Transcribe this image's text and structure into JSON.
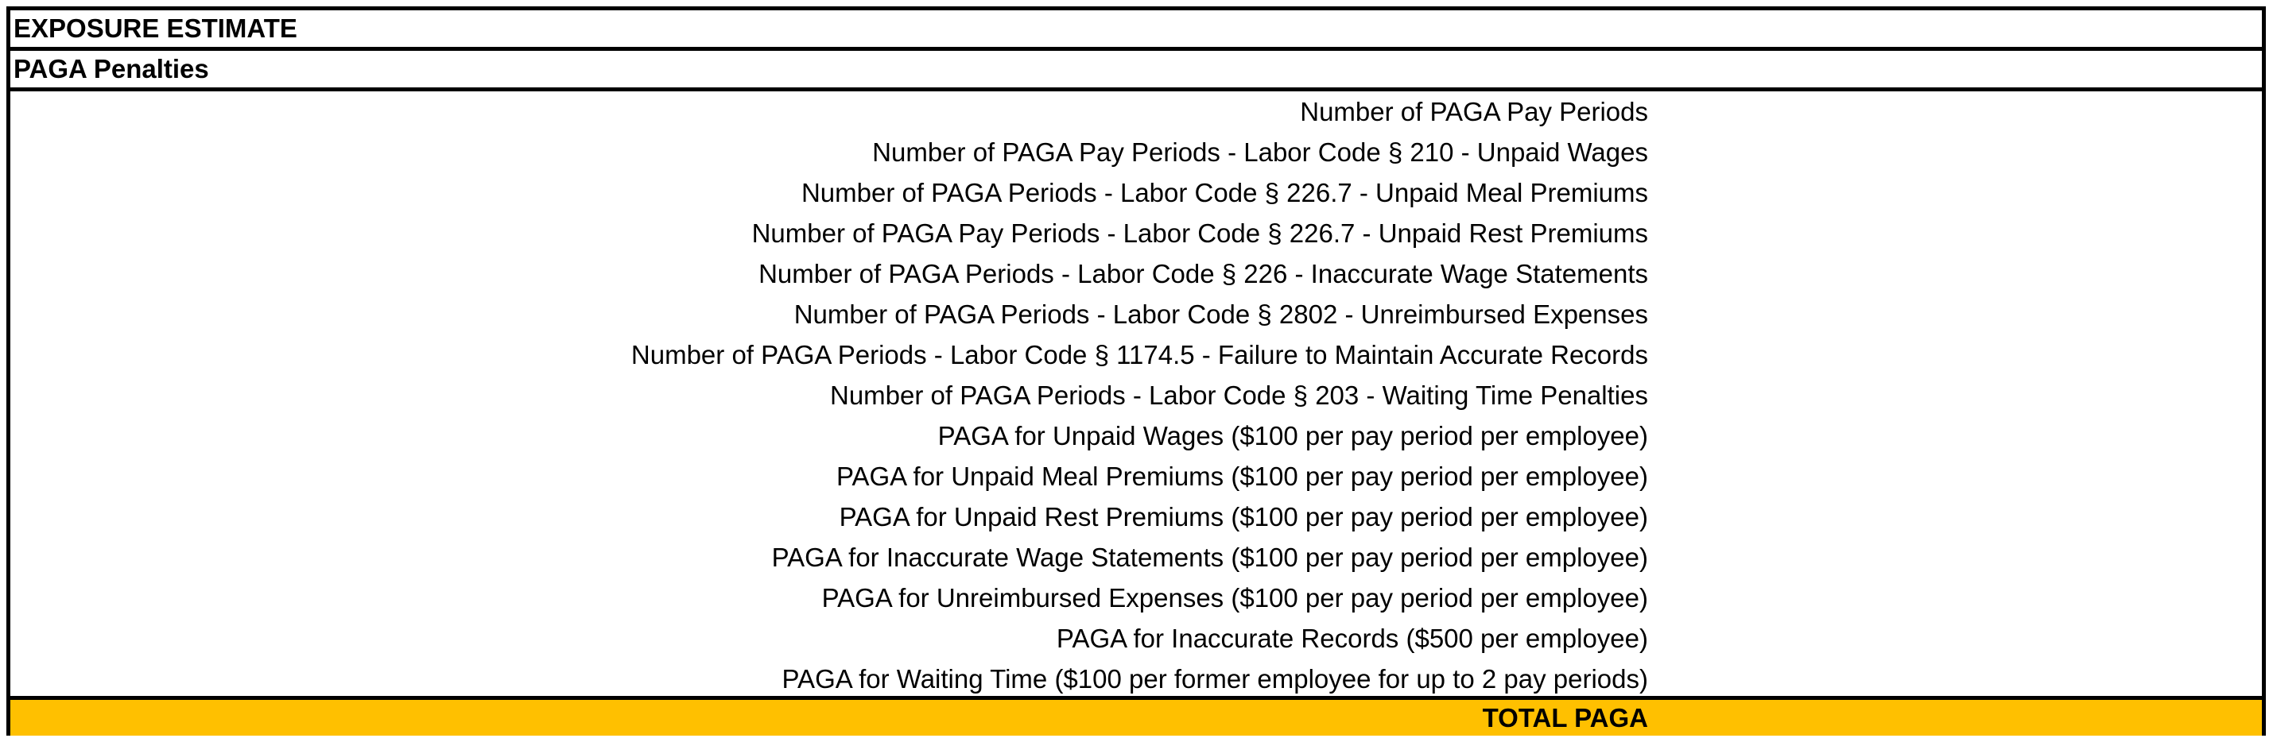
{
  "title": "EXPOSURE ESTIMATE",
  "section": "PAGA Penalties",
  "rows": [
    "Number of PAGA Pay Periods",
    "Number of PAGA Pay Periods - Labor Code § 210 - Unpaid Wages",
    "Number of PAGA Periods - Labor Code § 226.7 - Unpaid Meal Premiums",
    "Number of PAGA Pay Periods - Labor Code § 226.7 - Unpaid Rest Premiums",
    "Number of PAGA Periods - Labor Code § 226 - Inaccurate Wage Statements",
    "Number of PAGA Periods - Labor Code § 2802 - Unreimbursed Expenses",
    "Number of PAGA Periods - Labor Code § 1174.5 - Failure to Maintain Accurate Records",
    "Number of PAGA Periods - Labor Code § 203 - Waiting Time Penalties",
    "PAGA for Unpaid Wages ($100 per pay period per employee)",
    "PAGA for Unpaid Meal Premiums ($100 per pay period per employee)",
    "PAGA for Unpaid Rest Premiums ($100 per pay period per employee)",
    "PAGA for Inaccurate Wage Statements ($100 per pay period per employee)",
    "PAGA for Unreimbursed Expenses ($100 per pay period per employee)",
    "PAGA for Inaccurate Records ($500 per employee)",
    "PAGA for Waiting Time ($100 per former employee for up to 2 pay periods)"
  ],
  "total": {
    "label": "TOTAL PAGA",
    "highlight_color": "#ffc000"
  }
}
